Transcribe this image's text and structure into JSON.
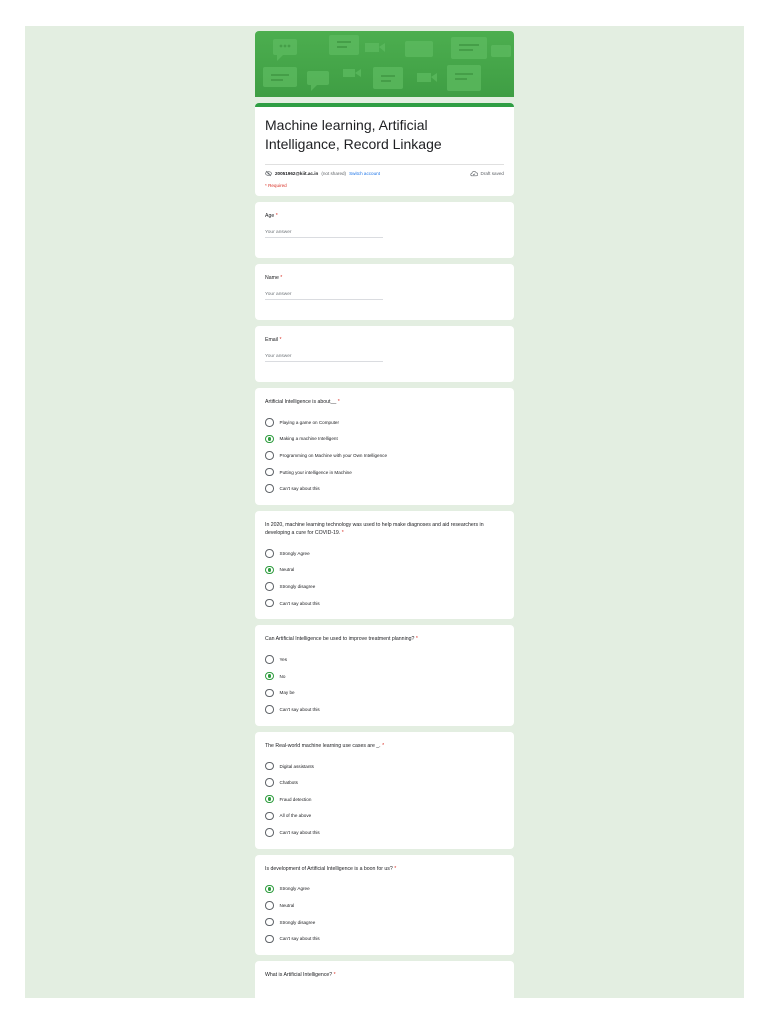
{
  "form": {
    "title": "Machine learning, Artificial Intelligance, Record Linkage",
    "account_email": "20051962@kiit.ac.in",
    "not_shared": "(not shared)",
    "switch_account": "Switch account",
    "draft_status": "Draft saved",
    "required_note": "* Required"
  },
  "theme": {
    "accent": "#2f9e44",
    "background": "#e3eee1",
    "required": "#d93025",
    "link": "#1a73e8"
  },
  "text_questions": [
    {
      "label": "Age",
      "required": "*",
      "placeholder": "Your answer"
    },
    {
      "label": "Name",
      "required": "*",
      "placeholder": "Your answer"
    },
    {
      "label": "Email",
      "required": "*",
      "placeholder": "Your answer"
    }
  ],
  "choice_questions": [
    {
      "label": "Artificial Intelligence is about__",
      "required": "*",
      "options": [
        "Playing a game on Computer",
        "Making a machine Intelligent",
        "Programming on Machine with your Own Intelligence",
        "Putting your intelligence in Machine",
        "Can't say about this"
      ],
      "selected": 1
    },
    {
      "label": "In 2020, machine learning technology was used to help make diagnoses and aid researchers in developing a cure for COVID-19.",
      "required": "*",
      "options": [
        "Strongly Agree",
        "Neutral",
        "Strongly disagree",
        "Can't say about this"
      ],
      "selected": 1
    },
    {
      "label": "Can Artificial Intelligence be used to improve treatment planning?",
      "required": "*",
      "options": [
        "Yes",
        "No",
        "May be",
        "Can't say about this"
      ],
      "selected": 1
    },
    {
      "label": "The Real-world machine learning use cases are _.",
      "required": "*",
      "options": [
        "Digital assistants",
        "Chatbots",
        "Fraud detection",
        "All of the above",
        "Can't say about this"
      ],
      "selected": 2
    },
    {
      "label": "Is development of Artificial Intelligence is a boon for us?",
      "required": "*",
      "options": [
        "Strongly Agree",
        "Neutral",
        "Strongly disagree",
        "Can't say about this"
      ],
      "selected": 0
    }
  ],
  "last_question": {
    "label": "What is Artificial Intelligence?",
    "required": "*"
  }
}
